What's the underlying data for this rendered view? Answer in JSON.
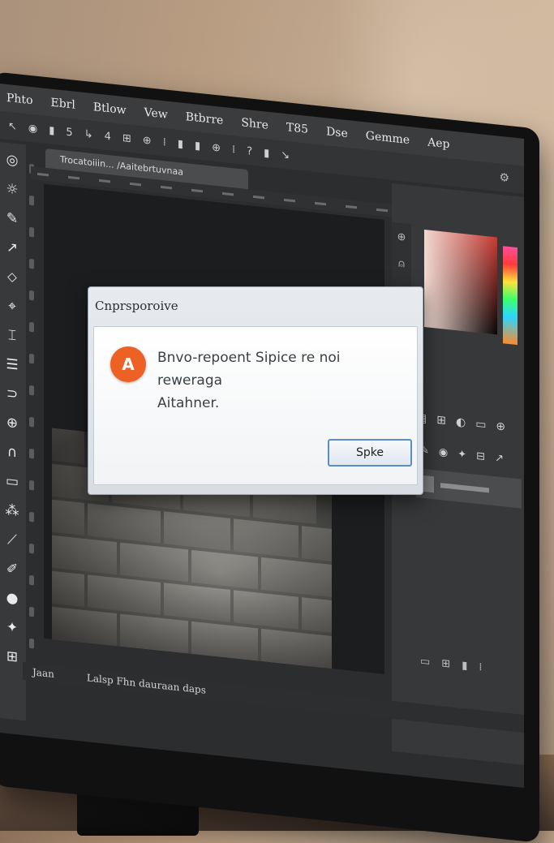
{
  "menu": [
    "Phto",
    "Ebrl",
    "Btlow",
    "Vew",
    "Btbrre",
    "Shre",
    "T85",
    "Dse",
    "Gemme",
    "Aep"
  ],
  "options_bar": {
    "glyphs": [
      "↖",
      "◉",
      "▮",
      "5",
      "↳",
      "4",
      "⊞",
      "⊕",
      "⁞",
      "▮",
      "▮",
      "⊕",
      "⁞",
      "?",
      "▮",
      "↘"
    ],
    "right_icon": "settings-icon"
  },
  "document_tab": "Trocatoiiin... /Aaitebrtuvnaa",
  "tools": [
    "◎",
    "☼",
    "✎",
    "↗",
    "⬦",
    "⌖",
    "⌶",
    "☰",
    "⊃",
    "⊕",
    "∩",
    "▭",
    "⁂",
    "⟋",
    "✐",
    "●",
    "✦",
    "⊞"
  ],
  "dialog": {
    "title": "Cnprsporoive",
    "message_line1": "Bnvo-repoent Sipice re noi reweraga",
    "message_line2": "Aitahner.",
    "icon_letter": "A",
    "ok_label": "Spke"
  },
  "status": {
    "left": "Jaan",
    "right": "Lalsp Fhn dauraan daps"
  },
  "colors": {
    "accent": "#ee6125",
    "button_border": "#5b8fc3"
  }
}
